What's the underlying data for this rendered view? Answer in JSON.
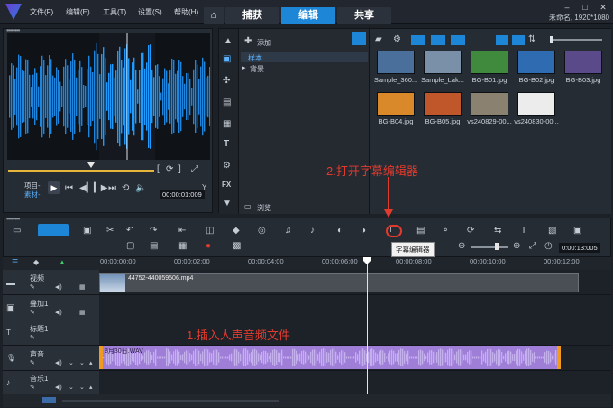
{
  "menu": {
    "file": "文件(F)",
    "edit": "编辑(E)",
    "tools": "工具(T)",
    "settings": "设置(S)",
    "help": "帮助(H)"
  },
  "tabs": {
    "capture": "捕获",
    "edit": "编辑",
    "share": "共享"
  },
  "project_info": "未命名, 1920*1080",
  "player": {
    "project_label": "项目-",
    "clip_label": "素材-",
    "timecode": "00:00:01:009"
  },
  "library": {
    "add_label": "添加",
    "tree": {
      "sample": "样本",
      "background": "背景"
    },
    "browse_label": "浏览",
    "items": [
      {
        "name": "Sample_360...",
        "color": "#4a6f9a"
      },
      {
        "name": "Sample_Lak...",
        "color": "#7a8fa8"
      },
      {
        "name": "BG-B01.jpg",
        "color": "#3f8a3c"
      },
      {
        "name": "BG-B02.jpg",
        "color": "#2f6bb0"
      },
      {
        "name": "BG-B03.jpg",
        "color": "#5a4a8a"
      },
      {
        "name": "BG-B04.jpg",
        "color": "#d9892a"
      },
      {
        "name": "BG-B05.jpg",
        "color": "#c0572a"
      },
      {
        "name": "vs240829-00...",
        "color": "#8a8170"
      },
      {
        "name": "vs240830-00...",
        "color": "#ececec"
      }
    ]
  },
  "tooltip": "字幕编辑器",
  "timeline": {
    "zoom_time": "0:00:13:005",
    "ruler": [
      "00:00:00:00",
      "00:00:02:00",
      "00:00:04:00",
      "00:00:06:00",
      "00:00:08:00",
      "00:00:10:00",
      "00:00:12:00"
    ],
    "tracks": {
      "video": "视频",
      "overlay": "叠加1",
      "title": "标题1",
      "voice": "声音",
      "music": "音乐1"
    },
    "video_clip": "44752-440059506.mp4",
    "audio_clip": "8月30日.WAV"
  },
  "annotations": {
    "step1": "1.插入人声音频文件",
    "step2": "2.打开字幕编辑器"
  },
  "colors": {
    "accent": "#1e86d6",
    "audio_clip": "#9f7ed8",
    "annotation": "#e23b2e"
  }
}
